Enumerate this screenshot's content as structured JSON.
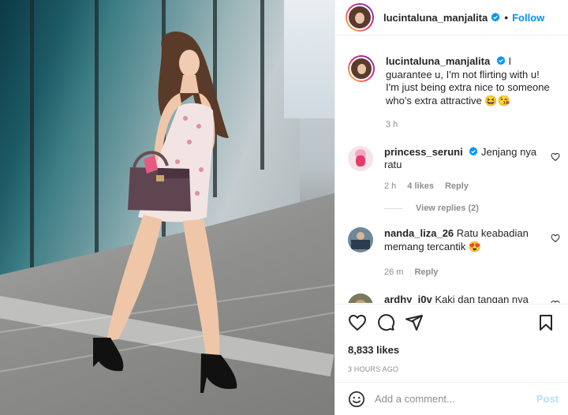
{
  "post": {
    "author": "lucintaluna_manjalita",
    "follow_label": "Follow",
    "caption": {
      "username": "lucintaluna_manjalita",
      "text": "I guarantee u, I'm not flirting with u! I'm just being extra nice to someone who's extra attractive 😆😘",
      "time": "3 h"
    },
    "comments": [
      {
        "username": "princess_seruni",
        "verified": true,
        "text": "Jenjang nya ratu",
        "time": "2 h",
        "likes": "4 likes",
        "reply_label": "Reply",
        "view_replies": "View replies (2)"
      },
      {
        "username": "nanda_liza_26",
        "text": "Ratu keabadian memang tercantik 😍",
        "time": "26 m",
        "reply_label": "Reply"
      },
      {
        "username": "ardhy_i0v",
        "text": "Kaki dan tangan nya"
      }
    ],
    "likes_count": "8,833 likes",
    "timestamp": "3 HOURS AGO",
    "add_comment_placeholder": "Add a comment...",
    "post_label": "Post"
  },
  "icons": {
    "like": "heart-icon",
    "comment": "comment-icon",
    "share": "share-icon",
    "save": "bookmark-icon",
    "emoji": "emoji-icon",
    "verified": "verified-badge-icon"
  },
  "colors": {
    "accent": "#0095f6",
    "post_disabled": "#b2dffc",
    "muted": "#8e8e8e"
  }
}
